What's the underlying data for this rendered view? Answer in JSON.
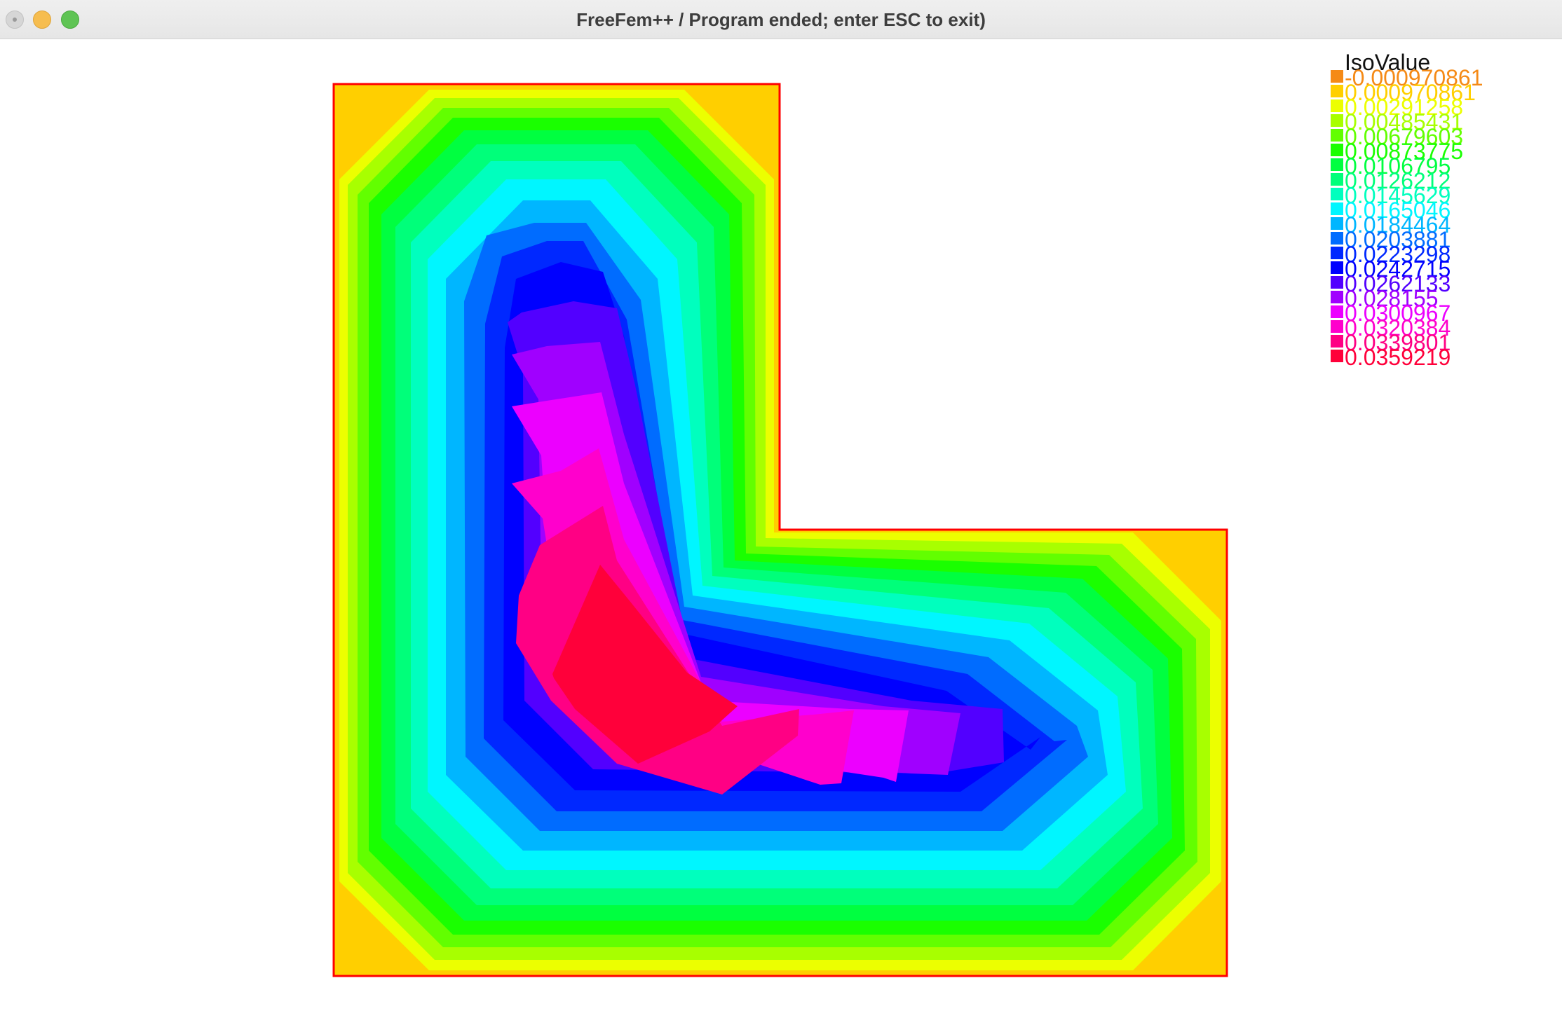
{
  "window": {
    "title": "FreeFem++ / Program ended; enter ESC to exit)"
  },
  "legend": {
    "title": "IsoValue",
    "items": [
      {
        "label": "-0.000970861",
        "color": "#f58a16"
      },
      {
        "label": "0.000970861",
        "color": "#ffcf00"
      },
      {
        "label": "0.00291258",
        "color": "#ecff00"
      },
      {
        "label": "0.00485431",
        "color": "#a8ff00"
      },
      {
        "label": "0.00679603",
        "color": "#62ff00"
      },
      {
        "label": "0.00873775",
        "color": "#1aff00"
      },
      {
        "label": "0.0106795",
        "color": "#00ff40"
      },
      {
        "label": "0.0126212",
        "color": "#00ff7a"
      },
      {
        "label": "0.0145629",
        "color": "#00ffbe"
      },
      {
        "label": "0.0165046",
        "color": "#00f6ff"
      },
      {
        "label": "0.0184464",
        "color": "#00b6ff"
      },
      {
        "label": "0.0203881",
        "color": "#006cff"
      },
      {
        "label": "0.0223298",
        "color": "#0028ff"
      },
      {
        "label": "0.0242715",
        "color": "#0000ff"
      },
      {
        "label": "0.0262133",
        "color": "#5200ff"
      },
      {
        "label": "0.028155",
        "color": "#a000ff"
      },
      {
        "label": "0.0300967",
        "color": "#ec00ff"
      },
      {
        "label": "0.0320384",
        "color": "#ff00cc"
      },
      {
        "label": "0.0339801",
        "color": "#ff0084"
      },
      {
        "label": "0.0359219",
        "color": "#ff003a"
      }
    ]
  },
  "plot": {
    "boundary_color": "#ff0000",
    "corner_color": "#ffcf00"
  }
}
